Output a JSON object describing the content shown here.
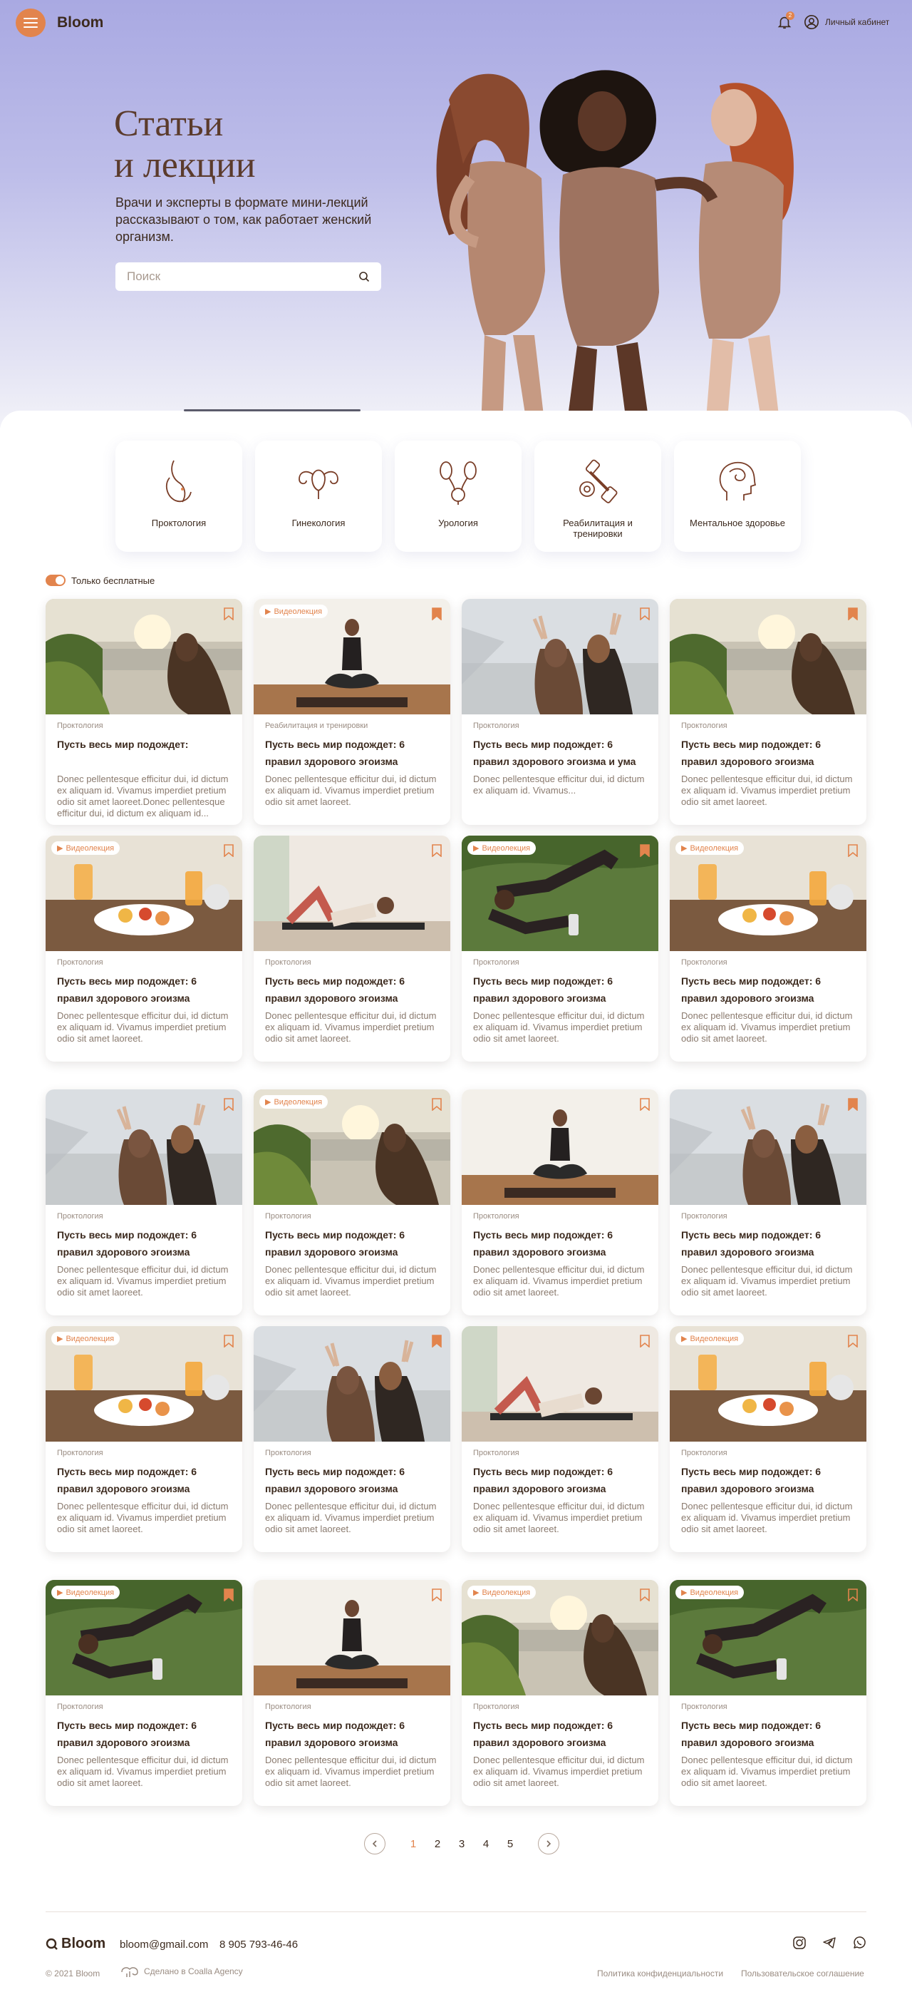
{
  "header": {
    "logo": "Bloom",
    "notification_count": "2",
    "account_label": "Личный кабинет"
  },
  "hero": {
    "title_line1": "Статьи",
    "title_line2": "и лекции",
    "subtitle": "Врачи и эксперты в формате мини-лекций рассказывают о том, как работает женский организм.",
    "search_placeholder": "Поиск"
  },
  "categories": [
    {
      "label": "Проктология",
      "icon": "proctology-icon"
    },
    {
      "label": "Гинекология",
      "icon": "gynecology-icon"
    },
    {
      "label": "Урология",
      "icon": "urology-icon"
    },
    {
      "label": "Реабилитация и тренировки",
      "icon": "rehab-icon"
    },
    {
      "label": "Ментальное здоровье",
      "icon": "mental-health-icon"
    }
  ],
  "filter": {
    "free_only_label": "Только бесплатные",
    "free_only_on": true
  },
  "cards": [
    {
      "img": "sunset",
      "video": false,
      "bookmarked": false,
      "category": "Проктология",
      "title": "Пусть весь мир подождет:",
      "desc": "Donec pellentesque efficitur dui, id dictum ex aliquam id. Vivamus imperdiet pretium odio sit amet laoreet.Donec pellentesque efficitur dui, id dictum ex aliquam id..."
    },
    {
      "img": "yoga",
      "video": true,
      "bookmarked": true,
      "category": "Реабилитация и тренировки",
      "title": "Пусть весь мир подождет: 6 правил здорового эгоизма",
      "desc": "Donec pellentesque efficitur dui, id dictum ex aliquam id. Vivamus imperdiet pretium odio sit amet laoreet."
    },
    {
      "img": "friends",
      "video": false,
      "bookmarked": false,
      "category": "Проктология",
      "title": "Пусть весь мир подождет: 6 правил здорового эгоизма и ума",
      "desc": "Donec pellentesque efficitur dui, id dictum ex aliquam id. Vivamus..."
    },
    {
      "img": "sunset",
      "video": false,
      "bookmarked": true,
      "category": "Проктология",
      "title": "Пусть весь мир подождет: 6 правил здорового эгоизма",
      "desc": "Donec pellentesque efficitur dui, id dictum ex aliquam id. Vivamus imperdiet pretium odio sit amet laoreet."
    },
    {
      "img": "breakfast",
      "video": true,
      "bookmarked": false,
      "category": "Проктология",
      "title": "Пусть весь мир подождет: 6 правил здорового эгоизма",
      "desc": "Donec pellentesque efficitur dui, id dictum ex aliquam id. Vivamus imperdiet pretium odio sit amet laoreet."
    },
    {
      "img": "crunch",
      "video": false,
      "bookmarked": false,
      "category": "Проктология",
      "title": "Пусть весь мир подождет: 6 правил здорового эгоизма",
      "desc": "Donec pellentesque efficitur dui, id dictum ex aliquam id. Vivamus imperdiet pretium odio sit amet laoreet."
    },
    {
      "img": "stretch",
      "video": true,
      "bookmarked": true,
      "category": "Проктология",
      "title": "Пусть весь мир подождет: 6 правил здорового эгоизма",
      "desc": "Donec pellentesque efficitur dui, id dictum ex aliquam id. Vivamus imperdiet pretium odio sit amet laoreet."
    },
    {
      "img": "breakfast",
      "video": true,
      "bookmarked": false,
      "category": "Проктология",
      "title": "Пусть весь мир подождет: 6 правил здорового эгоизма",
      "desc": "Donec pellentesque efficitur dui, id dictum ex aliquam id. Vivamus imperdiet pretium odio sit amet laoreet."
    },
    {
      "img": "friends",
      "video": false,
      "bookmarked": false,
      "category": "Проктология",
      "title": "Пусть весь мир подождет: 6 правил здорового эгоизма",
      "desc": "Donec pellentesque efficitur dui, id dictum ex aliquam id. Vivamus imperdiet pretium odio sit amet laoreet."
    },
    {
      "img": "sunset",
      "video": true,
      "bookmarked": false,
      "category": "Проктология",
      "title": "Пусть весь мир подождет: 6 правил здорового эгоизма",
      "desc": "Donec pellentesque efficitur dui, id dictum ex aliquam id. Vivamus imperdiet pretium odio sit amet laoreet."
    },
    {
      "img": "yoga",
      "video": false,
      "bookmarked": false,
      "category": "Проктология",
      "title": "Пусть весь мир подождет: 6 правил здорового эгоизма",
      "desc": "Donec pellentesque efficitur dui, id dictum ex aliquam id. Vivamus imperdiet pretium odio sit amet laoreet."
    },
    {
      "img": "friends",
      "video": false,
      "bookmarked": true,
      "category": "Проктология",
      "title": "Пусть весь мир подождет: 6 правил здорового эгоизма",
      "desc": "Donec pellentesque efficitur dui, id dictum ex aliquam id. Vivamus imperdiet pretium odio sit amet laoreet."
    },
    {
      "img": "breakfast",
      "video": true,
      "bookmarked": false,
      "category": "Проктология",
      "title": "Пусть весь мир подождет: 6 правил здорового эгоизма",
      "desc": "Donec pellentesque efficitur dui, id dictum ex aliquam id. Vivamus imperdiet pretium odio sit amet laoreet."
    },
    {
      "img": "friends",
      "video": false,
      "bookmarked": true,
      "category": "Проктология",
      "title": "Пусть весь мир подождет: 6 правил здорового эгоизма",
      "desc": "Donec pellentesque efficitur dui, id dictum ex aliquam id. Vivamus imperdiet pretium odio sit amet laoreet."
    },
    {
      "img": "crunch",
      "video": false,
      "bookmarked": false,
      "category": "Проктология",
      "title": "Пусть весь мир подождет: 6 правил здорового эгоизма",
      "desc": "Donec pellentesque efficitur dui, id dictum ex aliquam id. Vivamus imperdiet pretium odio sit amet laoreet."
    },
    {
      "img": "breakfast",
      "video": true,
      "bookmarked": false,
      "category": "Проктология",
      "title": "Пусть весь мир подождет: 6 правил здорового эгоизма",
      "desc": "Donec pellentesque efficitur dui, id dictum ex aliquam id. Vivamus imperdiet pretium odio sit amet laoreet."
    },
    {
      "img": "stretch",
      "video": true,
      "bookmarked": true,
      "category": "Проктология",
      "title": "Пусть весь мир подождет: 6 правил здорового эгоизма",
      "desc": "Donec pellentesque efficitur dui, id dictum ex aliquam id. Vivamus imperdiet pretium odio sit amet laoreet."
    },
    {
      "img": "yoga",
      "video": false,
      "bookmarked": false,
      "category": "Проктология",
      "title": "Пусть весь мир подождет: 6 правил здорового эгоизма",
      "desc": "Donec pellentesque efficitur dui, id dictum ex aliquam id. Vivamus imperdiet pretium odio sit amet laoreet."
    },
    {
      "img": "sunset",
      "video": true,
      "bookmarked": false,
      "category": "Проктология",
      "title": "Пусть весь мир подождет: 6 правил здорового эгоизма",
      "desc": "Donec pellentesque efficitur dui, id dictum ex aliquam id. Vivamus imperdiet pretium odio sit amet laoreet."
    },
    {
      "img": "stretch",
      "video": true,
      "bookmarked": false,
      "category": "Проктология",
      "title": "Пусть весь мир подождет: 6 правил здорового эгоизма",
      "desc": "Donec pellentesque efficitur dui, id dictum ex aliquam id. Vivamus imperdiet pretium odio sit amet laoreet."
    }
  ],
  "video_badge_label": "Видеолекция",
  "pagination": {
    "pages": [
      "1",
      "2",
      "3",
      "4",
      "5"
    ],
    "active": "1"
  },
  "footer": {
    "logo": "Bloom",
    "email": "bloom@gmail.com",
    "phone": "8 905 793-46-46",
    "copyright": "© 2021 Bloom",
    "made_by": "Сделано в Coalla Agency",
    "privacy": "Политика конфиденциальности",
    "terms": "Пользовательское соглашение",
    "social": [
      "instagram-icon",
      "telegram-icon",
      "whatsapp-icon"
    ]
  },
  "colors": {
    "accent": "#e2844d",
    "text": "#3c2a1e",
    "hero_bg": "#a9a9e2"
  }
}
